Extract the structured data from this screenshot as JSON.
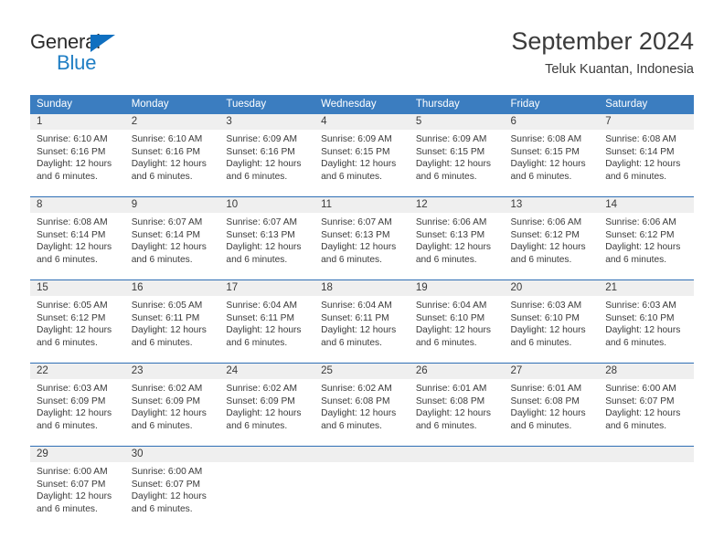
{
  "logo": {
    "word_one": "General",
    "word_two": "Blue",
    "triangle_color": "#0f6fc0",
    "blue_color": "#1f7ec4"
  },
  "header": {
    "title": "September 2024",
    "subtitle": "Teluk Kuantan, Indonesia"
  },
  "theme": {
    "header_blue": "#3b7dc0",
    "row_rule_blue": "#2f6fb5",
    "daynum_band": "#efefef",
    "text": "#3a3a3a"
  },
  "weekdays": [
    "Sunday",
    "Monday",
    "Tuesday",
    "Wednesday",
    "Thursday",
    "Friday",
    "Saturday"
  ],
  "labels": {
    "sunrise_prefix": "Sunrise:",
    "sunset_prefix": "Sunset:",
    "daylight_prefix": "Daylight:"
  },
  "weeks": [
    [
      {
        "day": "1",
        "sunrise": "Sunrise: 6:10 AM",
        "sunset": "Sunset: 6:16 PM",
        "daylight_1": "Daylight: 12 hours",
        "daylight_2": "and 6 minutes."
      },
      {
        "day": "2",
        "sunrise": "Sunrise: 6:10 AM",
        "sunset": "Sunset: 6:16 PM",
        "daylight_1": "Daylight: 12 hours",
        "daylight_2": "and 6 minutes."
      },
      {
        "day": "3",
        "sunrise": "Sunrise: 6:09 AM",
        "sunset": "Sunset: 6:16 PM",
        "daylight_1": "Daylight: 12 hours",
        "daylight_2": "and 6 minutes."
      },
      {
        "day": "4",
        "sunrise": "Sunrise: 6:09 AM",
        "sunset": "Sunset: 6:15 PM",
        "daylight_1": "Daylight: 12 hours",
        "daylight_2": "and 6 minutes."
      },
      {
        "day": "5",
        "sunrise": "Sunrise: 6:09 AM",
        "sunset": "Sunset: 6:15 PM",
        "daylight_1": "Daylight: 12 hours",
        "daylight_2": "and 6 minutes."
      },
      {
        "day": "6",
        "sunrise": "Sunrise: 6:08 AM",
        "sunset": "Sunset: 6:15 PM",
        "daylight_1": "Daylight: 12 hours",
        "daylight_2": "and 6 minutes."
      },
      {
        "day": "7",
        "sunrise": "Sunrise: 6:08 AM",
        "sunset": "Sunset: 6:14 PM",
        "daylight_1": "Daylight: 12 hours",
        "daylight_2": "and 6 minutes."
      }
    ],
    [
      {
        "day": "8",
        "sunrise": "Sunrise: 6:08 AM",
        "sunset": "Sunset: 6:14 PM",
        "daylight_1": "Daylight: 12 hours",
        "daylight_2": "and 6 minutes."
      },
      {
        "day": "9",
        "sunrise": "Sunrise: 6:07 AM",
        "sunset": "Sunset: 6:14 PM",
        "daylight_1": "Daylight: 12 hours",
        "daylight_2": "and 6 minutes."
      },
      {
        "day": "10",
        "sunrise": "Sunrise: 6:07 AM",
        "sunset": "Sunset: 6:13 PM",
        "daylight_1": "Daylight: 12 hours",
        "daylight_2": "and 6 minutes."
      },
      {
        "day": "11",
        "sunrise": "Sunrise: 6:07 AM",
        "sunset": "Sunset: 6:13 PM",
        "daylight_1": "Daylight: 12 hours",
        "daylight_2": "and 6 minutes."
      },
      {
        "day": "12",
        "sunrise": "Sunrise: 6:06 AM",
        "sunset": "Sunset: 6:13 PM",
        "daylight_1": "Daylight: 12 hours",
        "daylight_2": "and 6 minutes."
      },
      {
        "day": "13",
        "sunrise": "Sunrise: 6:06 AM",
        "sunset": "Sunset: 6:12 PM",
        "daylight_1": "Daylight: 12 hours",
        "daylight_2": "and 6 minutes."
      },
      {
        "day": "14",
        "sunrise": "Sunrise: 6:06 AM",
        "sunset": "Sunset: 6:12 PM",
        "daylight_1": "Daylight: 12 hours",
        "daylight_2": "and 6 minutes."
      }
    ],
    [
      {
        "day": "15",
        "sunrise": "Sunrise: 6:05 AM",
        "sunset": "Sunset: 6:12 PM",
        "daylight_1": "Daylight: 12 hours",
        "daylight_2": "and 6 minutes."
      },
      {
        "day": "16",
        "sunrise": "Sunrise: 6:05 AM",
        "sunset": "Sunset: 6:11 PM",
        "daylight_1": "Daylight: 12 hours",
        "daylight_2": "and 6 minutes."
      },
      {
        "day": "17",
        "sunrise": "Sunrise: 6:04 AM",
        "sunset": "Sunset: 6:11 PM",
        "daylight_1": "Daylight: 12 hours",
        "daylight_2": "and 6 minutes."
      },
      {
        "day": "18",
        "sunrise": "Sunrise: 6:04 AM",
        "sunset": "Sunset: 6:11 PM",
        "daylight_1": "Daylight: 12 hours",
        "daylight_2": "and 6 minutes."
      },
      {
        "day": "19",
        "sunrise": "Sunrise: 6:04 AM",
        "sunset": "Sunset: 6:10 PM",
        "daylight_1": "Daylight: 12 hours",
        "daylight_2": "and 6 minutes."
      },
      {
        "day": "20",
        "sunrise": "Sunrise: 6:03 AM",
        "sunset": "Sunset: 6:10 PM",
        "daylight_1": "Daylight: 12 hours",
        "daylight_2": "and 6 minutes."
      },
      {
        "day": "21",
        "sunrise": "Sunrise: 6:03 AM",
        "sunset": "Sunset: 6:10 PM",
        "daylight_1": "Daylight: 12 hours",
        "daylight_2": "and 6 minutes."
      }
    ],
    [
      {
        "day": "22",
        "sunrise": "Sunrise: 6:03 AM",
        "sunset": "Sunset: 6:09 PM",
        "daylight_1": "Daylight: 12 hours",
        "daylight_2": "and 6 minutes."
      },
      {
        "day": "23",
        "sunrise": "Sunrise: 6:02 AM",
        "sunset": "Sunset: 6:09 PM",
        "daylight_1": "Daylight: 12 hours",
        "daylight_2": "and 6 minutes."
      },
      {
        "day": "24",
        "sunrise": "Sunrise: 6:02 AM",
        "sunset": "Sunset: 6:09 PM",
        "daylight_1": "Daylight: 12 hours",
        "daylight_2": "and 6 minutes."
      },
      {
        "day": "25",
        "sunrise": "Sunrise: 6:02 AM",
        "sunset": "Sunset: 6:08 PM",
        "daylight_1": "Daylight: 12 hours",
        "daylight_2": "and 6 minutes."
      },
      {
        "day": "26",
        "sunrise": "Sunrise: 6:01 AM",
        "sunset": "Sunset: 6:08 PM",
        "daylight_1": "Daylight: 12 hours",
        "daylight_2": "and 6 minutes."
      },
      {
        "day": "27",
        "sunrise": "Sunrise: 6:01 AM",
        "sunset": "Sunset: 6:08 PM",
        "daylight_1": "Daylight: 12 hours",
        "daylight_2": "and 6 minutes."
      },
      {
        "day": "28",
        "sunrise": "Sunrise: 6:00 AM",
        "sunset": "Sunset: 6:07 PM",
        "daylight_1": "Daylight: 12 hours",
        "daylight_2": "and 6 minutes."
      }
    ],
    [
      {
        "day": "29",
        "sunrise": "Sunrise: 6:00 AM",
        "sunset": "Sunset: 6:07 PM",
        "daylight_1": "Daylight: 12 hours",
        "daylight_2": "and 6 minutes."
      },
      {
        "day": "30",
        "sunrise": "Sunrise: 6:00 AM",
        "sunset": "Sunset: 6:07 PM",
        "daylight_1": "Daylight: 12 hours",
        "daylight_2": "and 6 minutes."
      },
      {
        "day": "",
        "sunrise": "",
        "sunset": "",
        "daylight_1": "",
        "daylight_2": ""
      },
      {
        "day": "",
        "sunrise": "",
        "sunset": "",
        "daylight_1": "",
        "daylight_2": ""
      },
      {
        "day": "",
        "sunrise": "",
        "sunset": "",
        "daylight_1": "",
        "daylight_2": ""
      },
      {
        "day": "",
        "sunrise": "",
        "sunset": "",
        "daylight_1": "",
        "daylight_2": ""
      },
      {
        "day": "",
        "sunrise": "",
        "sunset": "",
        "daylight_1": "",
        "daylight_2": ""
      }
    ]
  ]
}
